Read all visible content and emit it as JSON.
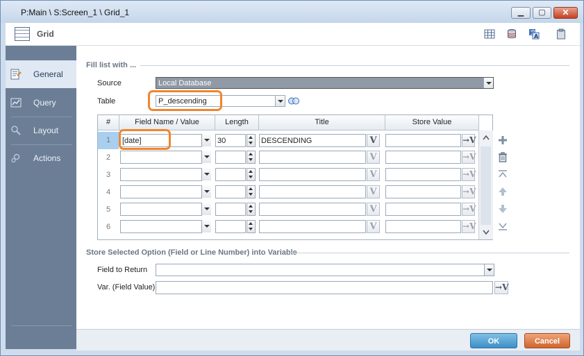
{
  "window": {
    "title": "P:Main \\ S:Screen_1 \\ Grid_1"
  },
  "header": {
    "title": "Grid"
  },
  "sidebar": {
    "items": [
      {
        "label": "General",
        "icon": "general-icon"
      },
      {
        "label": "Query",
        "icon": "query-icon"
      },
      {
        "label": "Layout",
        "icon": "layout-icon"
      },
      {
        "label": "Actions",
        "icon": "actions-icon"
      }
    ]
  },
  "fill": {
    "section_title": "Fill list with ...",
    "source_label": "Source",
    "source_value": "Local Database",
    "table_label": "Table",
    "table_value": "P_descending"
  },
  "grid": {
    "headers": [
      "#",
      "Field Name / Value",
      "Length",
      "Title",
      "Store Value"
    ],
    "rows": [
      {
        "num": "1",
        "field": "[date]",
        "length": "30",
        "title": "DESCENDING",
        "store": ""
      },
      {
        "num": "2",
        "field": "",
        "length": "",
        "title": "",
        "store": ""
      },
      {
        "num": "3",
        "field": "",
        "length": "",
        "title": "",
        "store": ""
      },
      {
        "num": "4",
        "field": "",
        "length": "",
        "title": "",
        "store": ""
      },
      {
        "num": "5",
        "field": "",
        "length": "",
        "title": "",
        "store": ""
      },
      {
        "num": "6",
        "field": "",
        "length": "",
        "title": "",
        "store": ""
      }
    ],
    "v_label": "V"
  },
  "store": {
    "section_title": "Store Selected Option (Field or Line Number) into Variable",
    "field_return_label": "Field to Return",
    "field_return_value": "",
    "var_label": "Var. (Field Value)",
    "var_value": ""
  },
  "footer": {
    "ok_label": "OK",
    "cancel_label": "Cancel"
  },
  "colors": {
    "accent_orange": "#f0852d",
    "sidebar": "#6b7e96",
    "ok": "#3d8fc6",
    "cancel": "#d0652d"
  }
}
